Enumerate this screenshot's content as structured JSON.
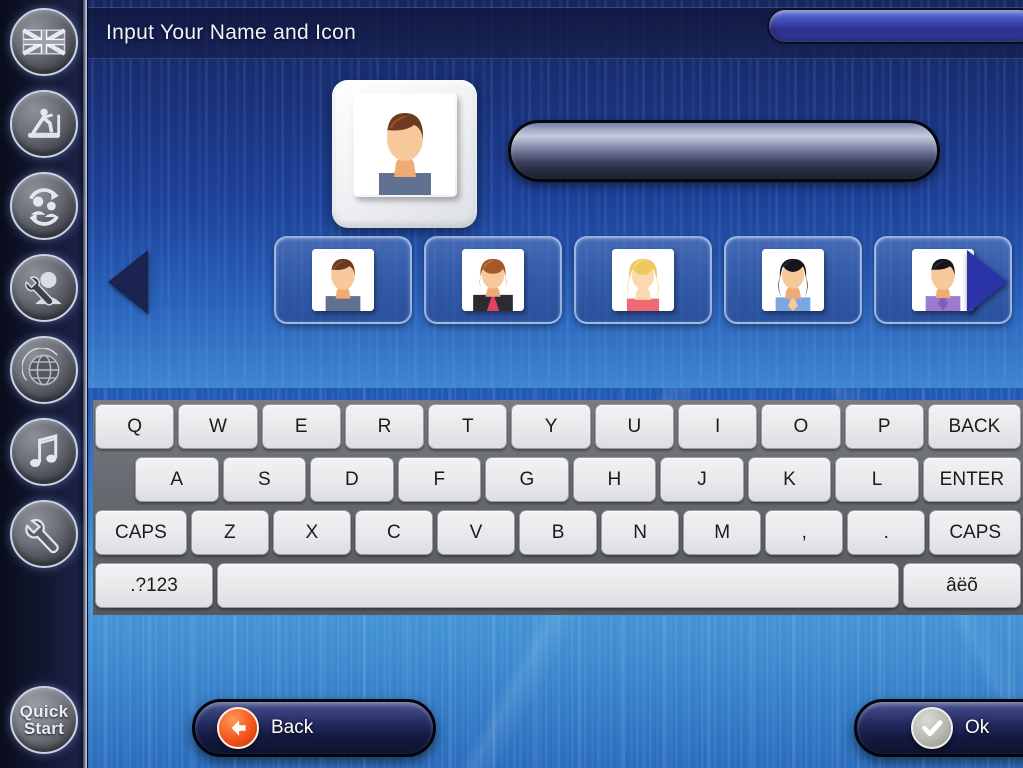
{
  "header": {
    "title": "Input Your Name and Icon",
    "pill_label": ""
  },
  "sidebar": {
    "items": [
      {
        "name": "language-flag",
        "icon": "union-jack-flag-icon",
        "label": ""
      },
      {
        "name": "workout-treadmill",
        "icon": "treadmill-runner-icon",
        "label": ""
      },
      {
        "name": "user-exchange",
        "icon": "users-sync-icon",
        "label": ""
      },
      {
        "name": "user-settings",
        "icon": "user-wrench-icon",
        "label": ""
      },
      {
        "name": "globe",
        "icon": "globe-icon",
        "label": ""
      },
      {
        "name": "music",
        "icon": "music-note-icon",
        "label": ""
      },
      {
        "name": "tools",
        "icon": "wrench-icon",
        "label": ""
      }
    ],
    "quick_start": {
      "line1": "Quick",
      "line2": "Start"
    }
  },
  "name_input": {
    "value": "",
    "placeholder": ""
  },
  "avatar_preview": {
    "icon": "avatar-male-brown-hair",
    "hair": "#6b3a20",
    "hair_light": "#8c5230",
    "skin": "#f7c99a",
    "shirt": "#61718f"
  },
  "carousel": {
    "left_arrow_label": "",
    "right_arrow_label": "",
    "left_arrow_enabled": false,
    "right_arrow_enabled": true,
    "selected_index": 0,
    "avatars": [
      {
        "name": "avatar-male-brown-hair",
        "hair": "#6b3a20",
        "hair_light": "#8c5230",
        "skin": "#f7c99a",
        "shirt": "#61718f",
        "hair_style": "short",
        "collar": ""
      },
      {
        "name": "avatar-female-auburn",
        "hair": "#a35a2a",
        "hair_light": "#c2743d",
        "skin": "#f7c99a",
        "shirt": "#2b2b31",
        "hair_style": "bob",
        "collar": "#e0415f"
      },
      {
        "name": "avatar-female-blonde",
        "hair": "#f0c860",
        "hair_light": "#f7dc8d",
        "skin": "#fbd9b0",
        "shirt": "#ef6a74",
        "hair_style": "long",
        "collar": ""
      },
      {
        "name": "avatar-female-black-hair",
        "hair": "#16161a",
        "hair_light": "#2d2d34",
        "skin": "#f7c99a",
        "shirt": "#7ba7e0",
        "hair_style": "long",
        "collar": ""
      },
      {
        "name": "avatar-male-black-hair",
        "hair": "#16161a",
        "hair_light": "#2d2d34",
        "skin": "#f7c99a",
        "shirt": "#9a7bd0",
        "hair_style": "short",
        "collar": "#7f5fb8"
      }
    ]
  },
  "keyboard": {
    "row1": [
      "Q",
      "W",
      "E",
      "R",
      "T",
      "Y",
      "U",
      "I",
      "O",
      "P",
      "BACK"
    ],
    "row2": [
      "A",
      "S",
      "D",
      "F",
      "G",
      "H",
      "J",
      "K",
      "L",
      "ENTER"
    ],
    "row3": [
      "CAPS",
      "Z",
      "X",
      "C",
      "V",
      "B",
      "N",
      "M",
      ",",
      ".",
      "CAPS"
    ],
    "row4": [
      ".?123",
      "",
      "âëõ"
    ]
  },
  "footer": {
    "back_label": "Back",
    "back_icon": "arrow-left-circle-icon",
    "ok_label": "Ok",
    "ok_icon": "check-circle-icon"
  },
  "colors": {
    "accent_blue": "#2a34a8",
    "back_icon_orange": "#f4541b",
    "ok_icon_gray": "#b7b9b0",
    "panel_blue": "#1e4198",
    "key_face": "#eceef2"
  }
}
